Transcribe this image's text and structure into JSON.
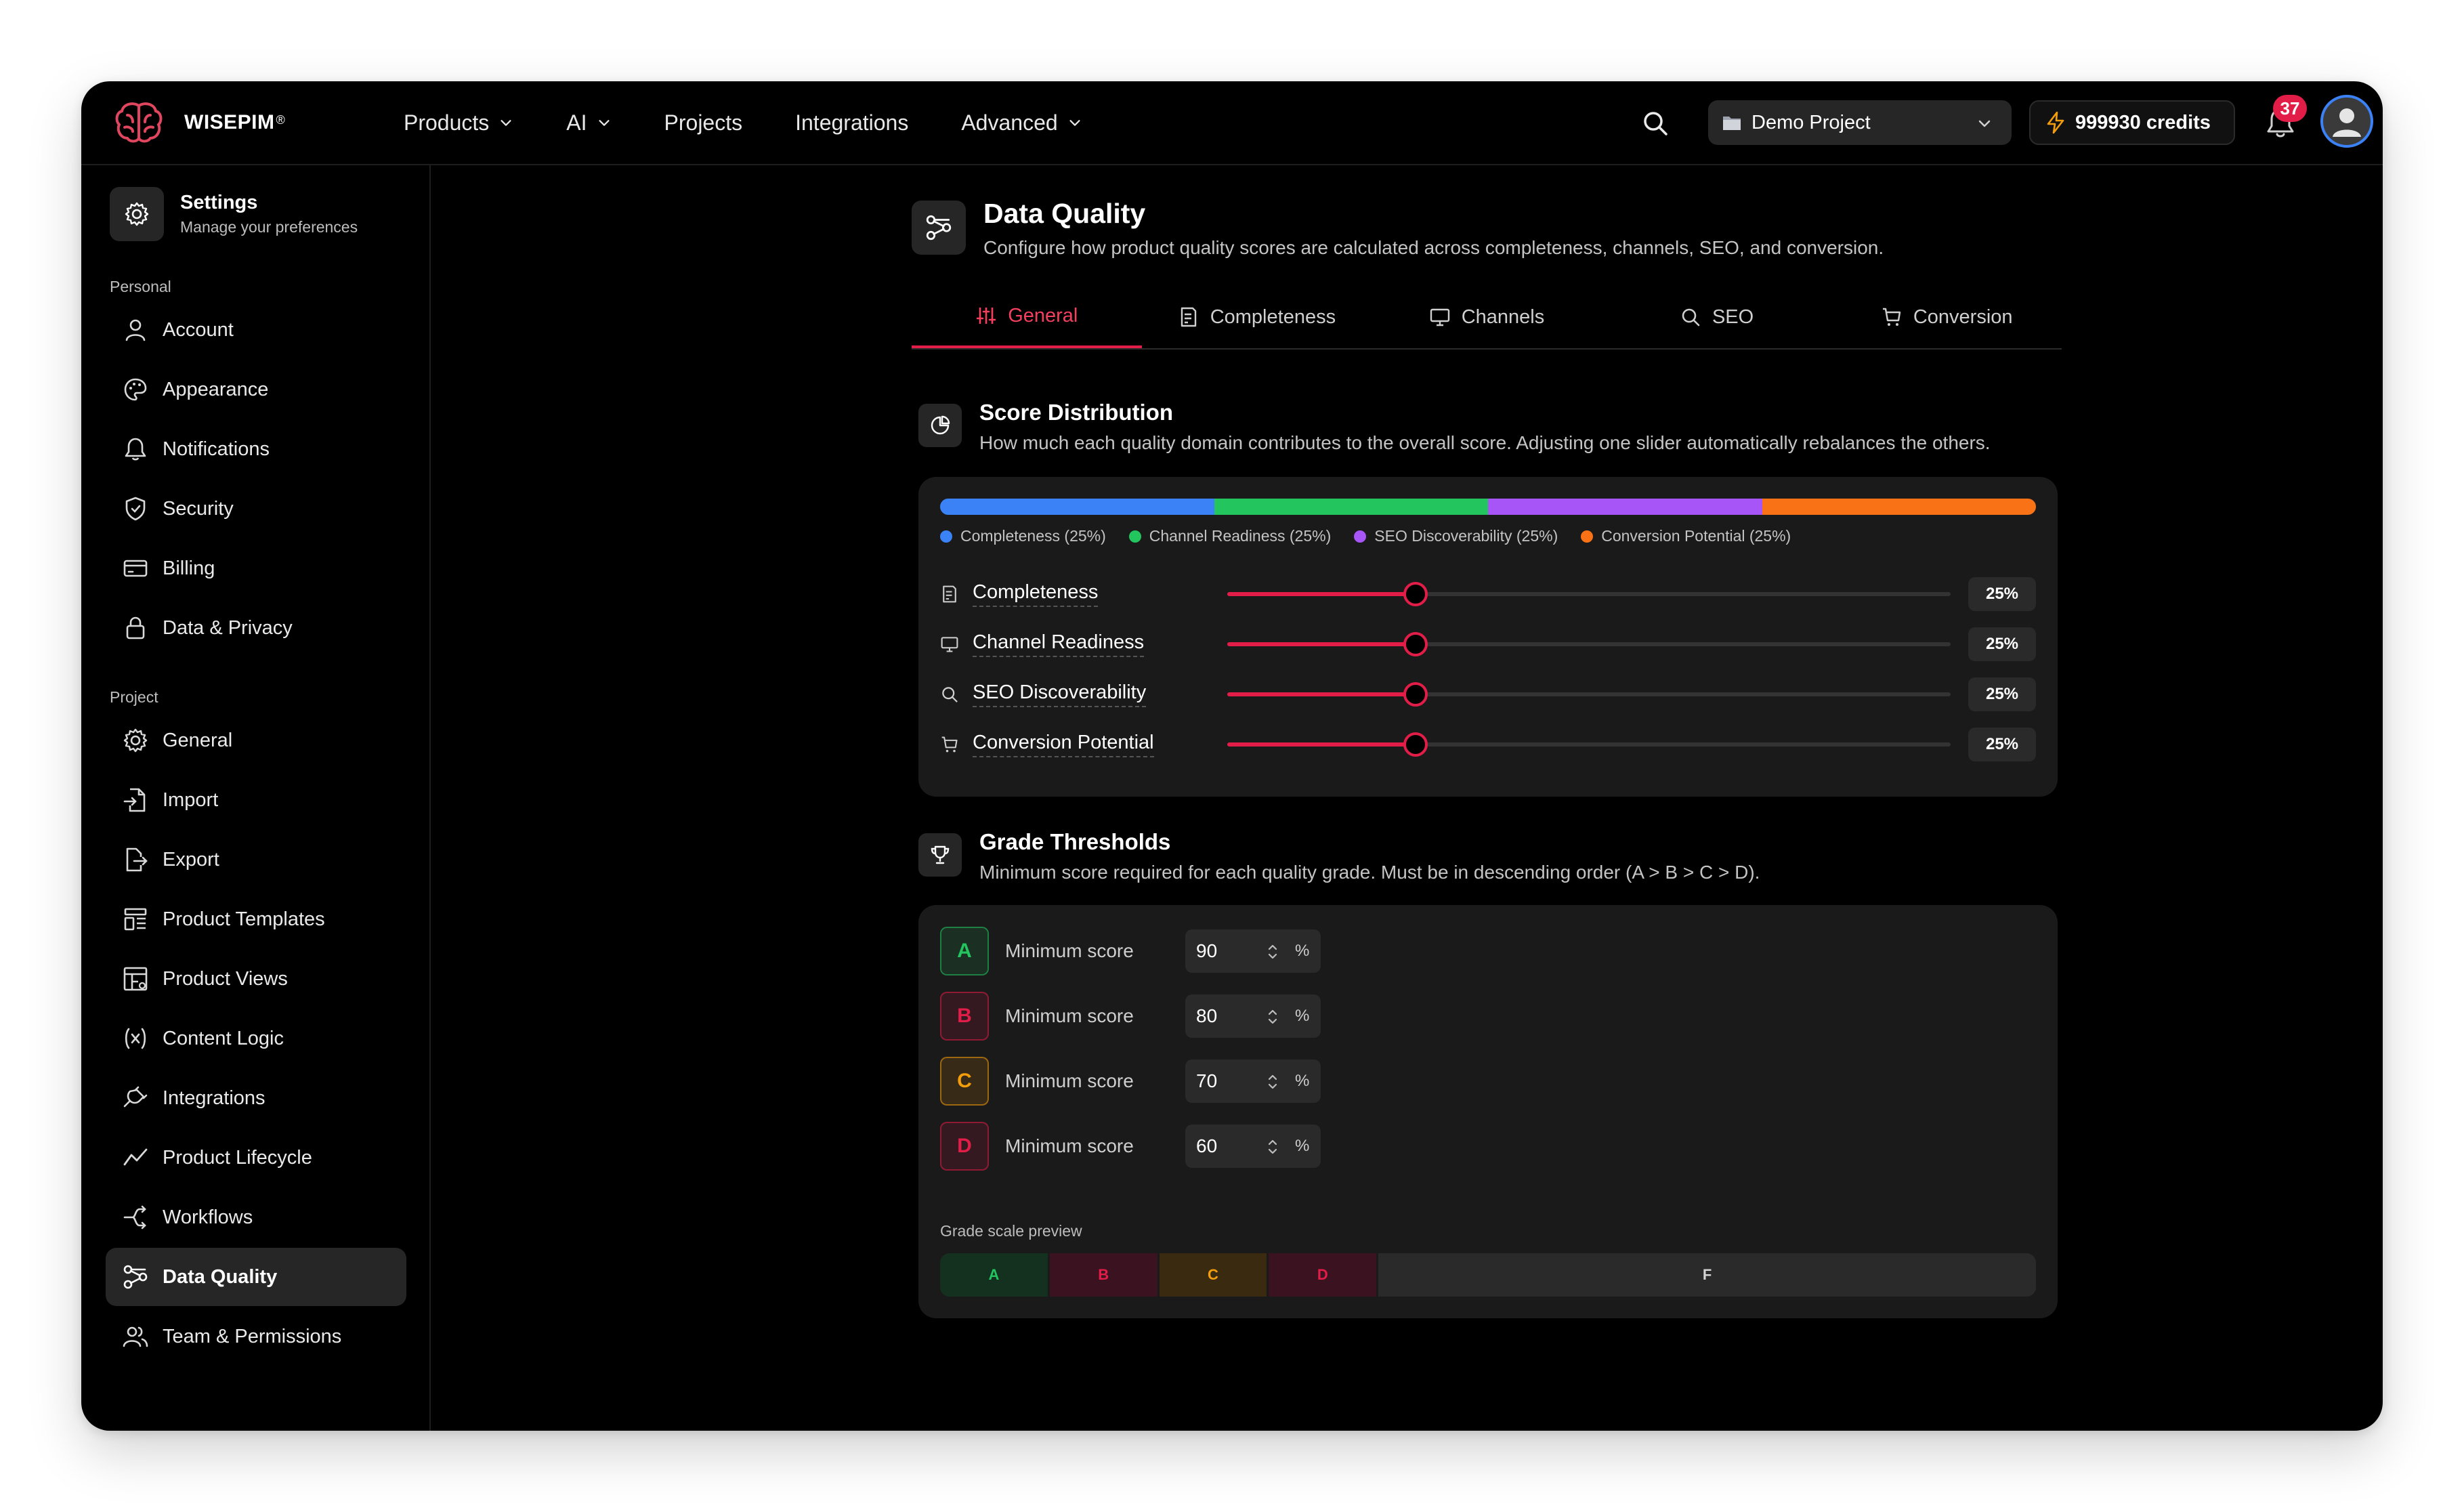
{
  "app": {
    "brand": "WISEPIM",
    "brand_mark": "®"
  },
  "nav": {
    "items": [
      {
        "label": "Products",
        "dropdown": true
      },
      {
        "label": "AI",
        "dropdown": true
      },
      {
        "label": "Projects",
        "dropdown": false
      },
      {
        "label": "Integrations",
        "dropdown": false
      },
      {
        "label": "Advanced",
        "dropdown": true
      }
    ],
    "project": "Demo Project",
    "credits": "999930 credits",
    "notification_count": "37"
  },
  "sidebar": {
    "title": "Settings",
    "subtitle": "Manage your preferences",
    "personal_label": "Personal",
    "project_label": "Project",
    "personal": [
      {
        "label": "Account",
        "icon": "user-icon"
      },
      {
        "label": "Appearance",
        "icon": "palette-icon"
      },
      {
        "label": "Notifications",
        "icon": "bell-icon"
      },
      {
        "label": "Security",
        "icon": "shield-icon"
      },
      {
        "label": "Billing",
        "icon": "credit-card-icon"
      },
      {
        "label": "Data & Privacy",
        "icon": "lock-icon"
      }
    ],
    "project": [
      {
        "label": "General",
        "icon": "gear-icon"
      },
      {
        "label": "Import",
        "icon": "file-import-icon"
      },
      {
        "label": "Export",
        "icon": "file-export-icon"
      },
      {
        "label": "Product Templates",
        "icon": "template-icon"
      },
      {
        "label": "Product Views",
        "icon": "table-view-icon"
      },
      {
        "label": "Content Logic",
        "icon": "variable-icon"
      },
      {
        "label": "Integrations",
        "icon": "plug-icon"
      },
      {
        "label": "Product Lifecycle",
        "icon": "trend-icon"
      },
      {
        "label": "Workflows",
        "icon": "workflow-icon"
      },
      {
        "label": "Data Quality",
        "icon": "data-quality-icon",
        "active": true
      },
      {
        "label": "Team & Permissions",
        "icon": "users-icon"
      }
    ]
  },
  "page": {
    "title": "Data Quality",
    "subtitle": "Configure how product quality scores are calculated across completeness, channels, SEO, and conversion.",
    "tabs": [
      {
        "label": "General",
        "icon": "sliders-icon",
        "active": true
      },
      {
        "label": "Completeness",
        "icon": "checklist-icon"
      },
      {
        "label": "Channels",
        "icon": "monitor-icon"
      },
      {
        "label": "SEO",
        "icon": "search-icon"
      },
      {
        "label": "Conversion",
        "icon": "cart-icon"
      }
    ]
  },
  "score_distribution": {
    "title": "Score Distribution",
    "description": "How much each quality domain contributes to the overall score. Adjusting one slider automatically rebalances the others.",
    "legend": [
      {
        "label": "Completeness (25%)",
        "color": "#3b82f6"
      },
      {
        "label": "Channel Readiness (25%)",
        "color": "#22c55e"
      },
      {
        "label": "SEO Discoverability (25%)",
        "color": "#a855f7"
      },
      {
        "label": "Conversion Potential (25%)",
        "color": "#f97316"
      }
    ],
    "shares": [
      0.25,
      0.25,
      0.25,
      0.25
    ],
    "sliders": [
      {
        "label": "Completeness",
        "value": 25,
        "display": "25%",
        "icon": "checklist-icon"
      },
      {
        "label": "Channel Readiness",
        "value": 25,
        "display": "25%",
        "icon": "monitor-icon"
      },
      {
        "label": "SEO Discoverability",
        "value": 25,
        "display": "25%",
        "icon": "search-icon"
      },
      {
        "label": "Conversion Potential",
        "value": 25,
        "display": "25%",
        "icon": "cart-icon"
      }
    ],
    "slider_fill_color": "#e11d48"
  },
  "grade_thresholds": {
    "title": "Grade Thresholds",
    "description": "Minimum score required for each quality grade. Must be in descending order (A > B > C > D).",
    "min_label": "Minimum score",
    "unit": "%",
    "grades": [
      {
        "letter": "A",
        "value": "90",
        "color": "#22c55e"
      },
      {
        "letter": "B",
        "value": "80",
        "color": "#e11d48"
      },
      {
        "letter": "C",
        "value": "70",
        "color": "#f59e0b"
      },
      {
        "letter": "D",
        "value": "60",
        "color": "#e11d48"
      }
    ],
    "scale_label": "Grade scale preview",
    "scale": [
      {
        "letter": "A",
        "share": 0.1
      },
      {
        "letter": "B",
        "share": 0.1
      },
      {
        "letter": "C",
        "share": 0.1
      },
      {
        "letter": "D",
        "share": 0.1
      },
      {
        "letter": "F",
        "share": 0.6
      }
    ]
  }
}
